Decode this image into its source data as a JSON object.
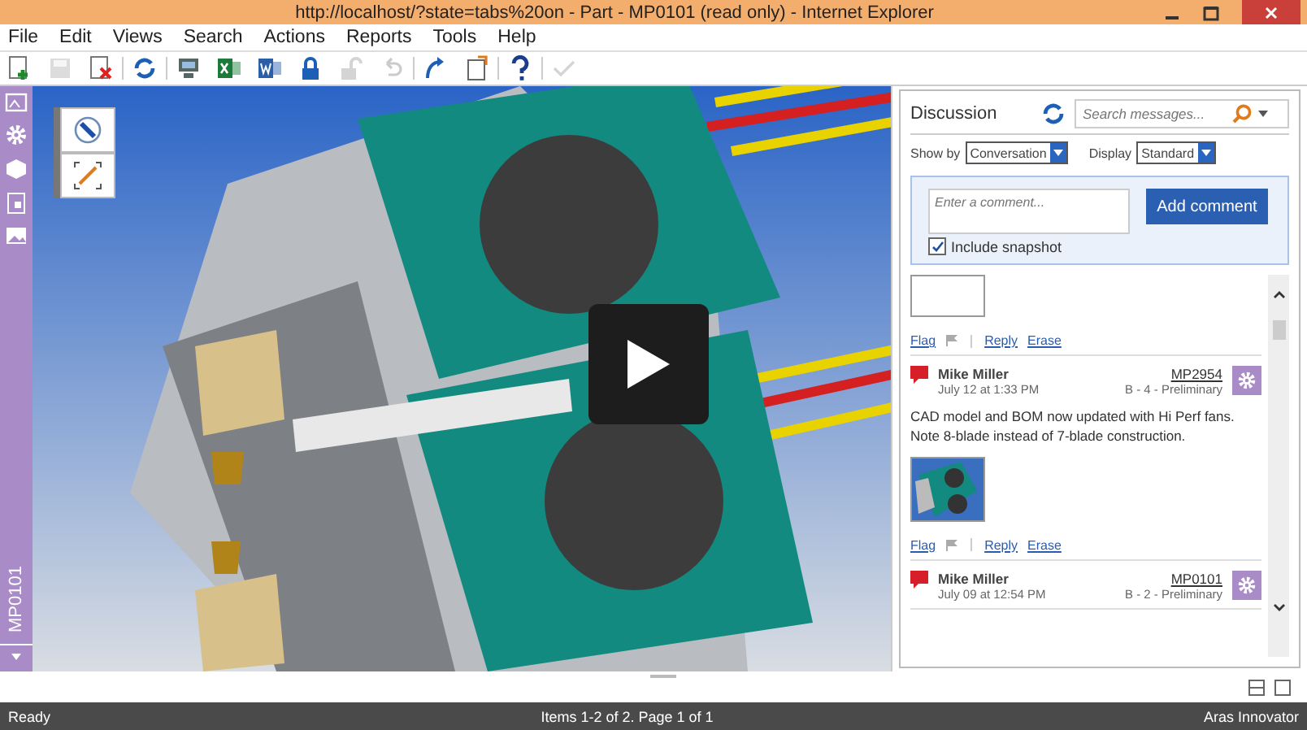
{
  "window": {
    "title": "http://localhost/?state=tabs%20on - Part - MP0101 (read only) - Internet Explorer"
  },
  "menu": [
    "File",
    "Edit",
    "Views",
    "Search",
    "Actions",
    "Reports",
    "Tools",
    "Help"
  ],
  "toolbar": [
    {
      "kind": "new",
      "disabled": false
    },
    {
      "kind": "save",
      "disabled": true
    },
    {
      "kind": "delete",
      "disabled": false
    },
    {
      "kind": "refresh",
      "disabled": false
    },
    {
      "kind": "print",
      "disabled": false
    },
    {
      "kind": "excel",
      "disabled": false
    },
    {
      "kind": "word",
      "disabled": false
    },
    {
      "kind": "lock",
      "disabled": false
    },
    {
      "kind": "unlock",
      "disabled": true
    },
    {
      "kind": "undo",
      "disabled": true
    },
    {
      "kind": "link",
      "disabled": false
    },
    {
      "kind": "copy",
      "disabled": false
    },
    {
      "kind": "help",
      "disabled": false
    },
    {
      "kind": "done",
      "disabled": true
    }
  ],
  "sidebar": {
    "tab_label": "MP0101"
  },
  "discussion": {
    "title": "Discussion",
    "search": {
      "placeholder": "Search messages..."
    },
    "show_by": {
      "label": "Show by",
      "value": "Conversation"
    },
    "display": {
      "label": "Display",
      "value": "Standard"
    },
    "comment": {
      "placeholder": "Enter a comment...",
      "button": "Add comment",
      "snapshot": {
        "label": "Include snapshot",
        "checked": true
      }
    },
    "messages": [
      {
        "links": [
          "Flag",
          "Reply",
          "Erase"
        ]
      },
      {
        "author": "Mike Miller",
        "date": "July 12 at 1:33 PM",
        "item": "MP2954",
        "status": "B - 4 - Preliminary",
        "text": "CAD model and BOM now updated with Hi Perf fans. Note 8-blade instead of 7-blade construction.",
        "links": [
          "Flag",
          "Reply",
          "Erase"
        ]
      },
      {
        "author": "Mike Miller",
        "date": "July 09 at 12:54 PM",
        "item": "MP0101",
        "status": "B - 2 - Preliminary"
      }
    ]
  },
  "status_bar": {
    "left": "Ready",
    "center": "Items 1-2 of 2. Page 1 of 1",
    "right": "Aras Innovator"
  }
}
